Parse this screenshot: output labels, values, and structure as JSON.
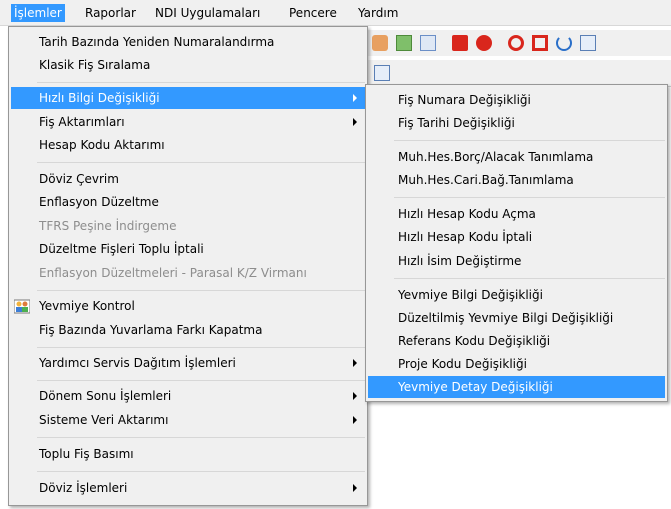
{
  "menubar": {
    "items": [
      {
        "label": "İşlemler"
      },
      {
        "label": "Raporlar"
      },
      {
        "label": "NDI Uygulamaları"
      },
      {
        "label": "Pencere"
      },
      {
        "label": "Yardım"
      }
    ]
  },
  "main_menu": {
    "items": [
      {
        "label": "Tarih Bazında Yeniden Numaralandırma"
      },
      {
        "label": "Klasik Fiş Sıralama"
      },
      {
        "label": "Hızlı Bilgi Değişikliği"
      },
      {
        "label": "Fiş Aktarımları"
      },
      {
        "label": "Hesap Kodu Aktarımı"
      },
      {
        "label": "Döviz Çevrim"
      },
      {
        "label": "Enflasyon Düzeltme"
      },
      {
        "label": "TFRS Peşine İndirgeme"
      },
      {
        "label": "Düzeltme Fişleri Toplu İptali"
      },
      {
        "label": "Enflasyon Düzeltmeleri - Parasal K/Z Virmanı"
      },
      {
        "label": "Yevmiye Kontrol"
      },
      {
        "label": "Fiş Bazında Yuvarlama Farkı Kapatma"
      },
      {
        "label": "Yardımcı Servis Dağıtım İşlemleri"
      },
      {
        "label": "Dönem Sonu İşlemleri"
      },
      {
        "label": "Sisteme Veri Aktarımı"
      },
      {
        "label": "Toplu Fiş Basımı"
      },
      {
        "label": "Döviz İşlemleri"
      }
    ]
  },
  "sub_menu": {
    "items": [
      {
        "label": "Fiş Numara Değişikliği"
      },
      {
        "label": "Fiş Tarihi Değişikliği"
      },
      {
        "label": "Muh.Hes.Borç/Alacak Tanımlama"
      },
      {
        "label": "Muh.Hes.Cari.Bağ.Tanımlama"
      },
      {
        "label": "Hızlı Hesap Kodu Açma"
      },
      {
        "label": "Hızlı Hesap Kodu İptali"
      },
      {
        "label": "Hızlı İsim Değiştirme"
      },
      {
        "label": "Yevmiye Bilgi Değişikliği"
      },
      {
        "label": "Düzeltilmiş Yevmiye Bilgi Değişikliği"
      },
      {
        "label": "Referans Kodu Değişikliği"
      },
      {
        "label": "Proje Kodu Değişikliği"
      },
      {
        "label": "Yevmiye Detay Değişikliği"
      }
    ]
  },
  "colors": {
    "highlight": "#3399ff",
    "menu_bg": "#f0f0f0",
    "disabled": "#8d8d8d"
  }
}
